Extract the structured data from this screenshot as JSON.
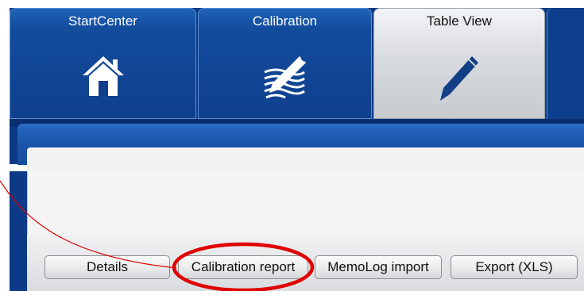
{
  "nav": {
    "tabs": [
      {
        "label": "StartCenter",
        "icon": "home-icon",
        "state": "inactive"
      },
      {
        "label": "Calibration",
        "icon": "calibration-pen-icon",
        "state": "inactive"
      },
      {
        "label": "Table View",
        "icon": "pen-icon",
        "state": "active"
      }
    ]
  },
  "toolbar": {
    "buttons": [
      {
        "label": "Details"
      },
      {
        "label": "Calibration report",
        "highlighted": true
      },
      {
        "label": "MemoLog import"
      },
      {
        "label": "Export (XLS)"
      }
    ]
  },
  "colors": {
    "panel_blue": "#0d3a86",
    "active_tab": "#d8dbdf",
    "annotation_red": "#e00000"
  }
}
